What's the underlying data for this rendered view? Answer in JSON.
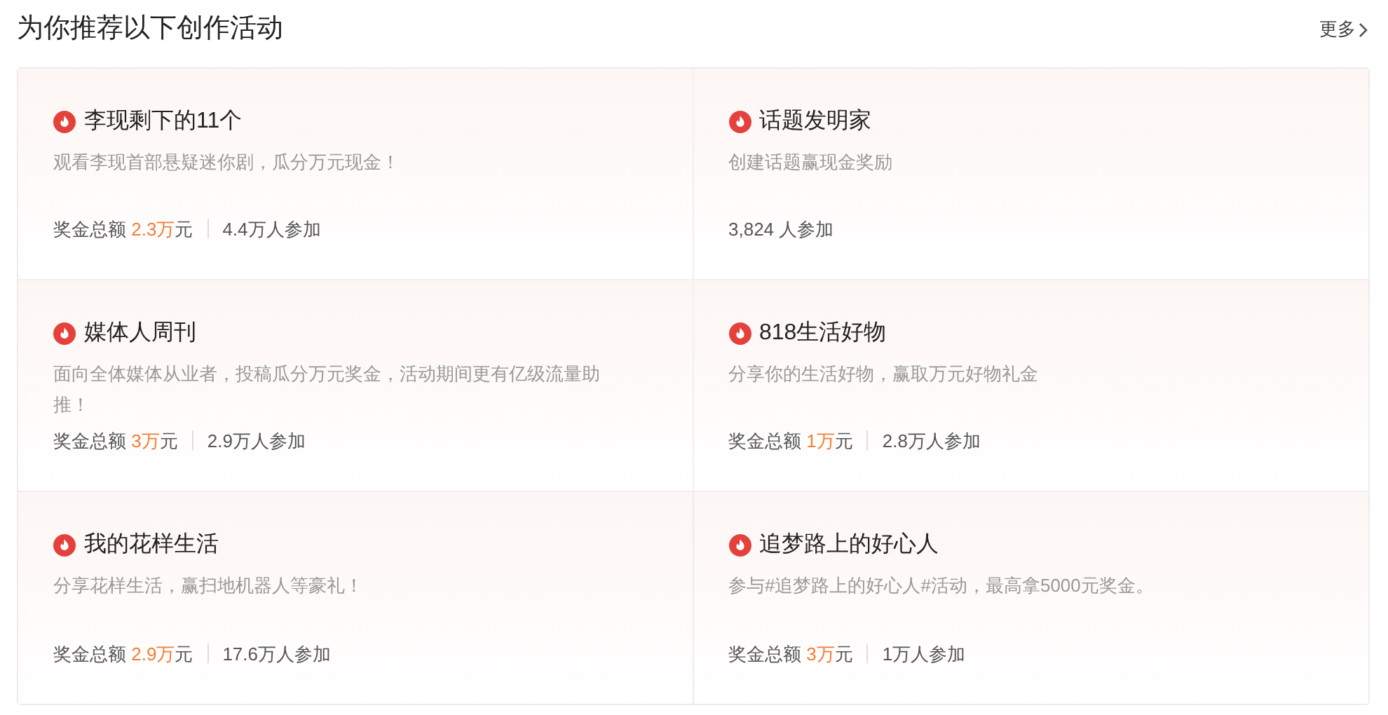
{
  "header": {
    "title": "为你推荐以下创作活动",
    "more_link": "更多"
  },
  "activities": [
    {
      "title": "李现剩下的11个",
      "description": "观看李现首部悬疑迷你剧，瓜分万元现金！",
      "prize": {
        "label": "奖金总额",
        "amount": "2.3万",
        "unit": "元"
      },
      "participants": "4.4万人参加"
    },
    {
      "title": "话题发明家",
      "description": "创建话题赢现金奖励",
      "participants": "3,824 人参加"
    },
    {
      "title": "媒体人周刊",
      "description": "面向全体媒体从业者，投稿瓜分万元奖金，活动期间更有亿级流量助推！",
      "prize": {
        "label": "奖金总额",
        "amount": "3万",
        "unit": "元"
      },
      "participants": "2.9万人参加"
    },
    {
      "title": "818生活好物",
      "description": "分享你的生活好物，赢取万元好物礼金",
      "prize": {
        "label": "奖金总额",
        "amount": "1万",
        "unit": "元"
      },
      "participants": "2.8万人参加"
    },
    {
      "title": "我的花样生活",
      "description": "分享花样生活，赢扫地机器人等豪礼！",
      "prize": {
        "label": "奖金总额",
        "amount": "2.9万",
        "unit": "元"
      },
      "participants": "17.6万人参加"
    },
    {
      "title": "追梦路上的好心人",
      "description": "参与#追梦路上的好心人#活动，最高拿5000元奖金。",
      "prize": {
        "label": "奖金总额",
        "amount": "3万",
        "unit": "元"
      },
      "participants": "1万人参加"
    }
  ]
}
